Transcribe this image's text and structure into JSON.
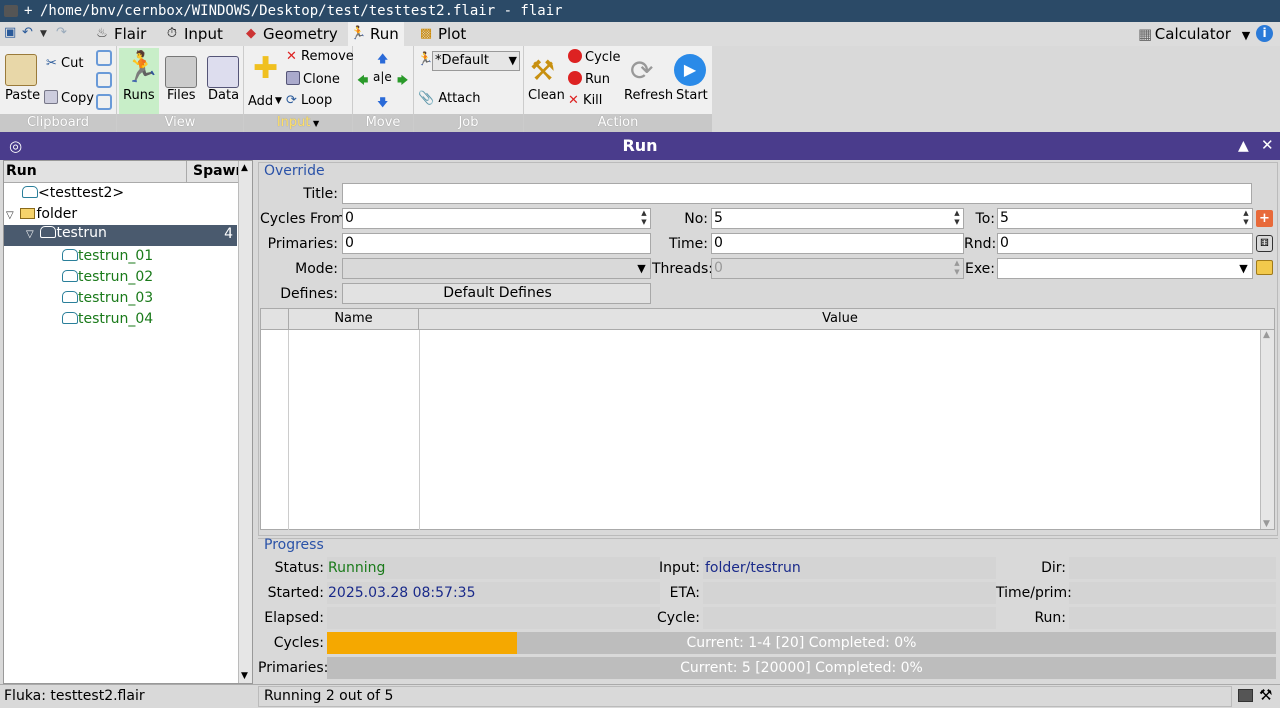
{
  "window": {
    "plus": "+",
    "title": "/home/bnv/cernbox/WINDOWS/Desktop/test/testtest2.flair - flair"
  },
  "tabs": [
    {
      "label": "Flair",
      "icon": "cauldron-icon"
    },
    {
      "label": "Input",
      "icon": "input-icon"
    },
    {
      "label": "Geometry",
      "icon": "geometry-icon"
    },
    {
      "label": "Run",
      "icon": "runner-icon"
    },
    {
      "label": "Plot",
      "icon": "plot-icon"
    }
  ],
  "calculator": "Calculator",
  "ribbon": {
    "clipboard": {
      "label": "Clipboard",
      "paste": "Paste",
      "cut": "Cut",
      "copy": "Copy"
    },
    "view": {
      "label": "View",
      "runs": "Runs",
      "files": "Files",
      "data": "Data"
    },
    "input": {
      "label": "Input",
      "add": "Add",
      "remove": "Remove",
      "clone": "Clone",
      "loop": "Loop"
    },
    "move": {
      "label": "Move"
    },
    "job": {
      "label": "Job",
      "default": "*Default",
      "attach": "Attach"
    },
    "action": {
      "label": "Action",
      "clean": "Clean",
      "cycle": "Cycle",
      "run": "Run",
      "kill": "Kill",
      "refresh": "Refresh",
      "start": "Start"
    }
  },
  "panel_title": "Run",
  "left": {
    "col_run": "Run",
    "col_spawn": "Spawn",
    "items": [
      {
        "label": "<testtest2>"
      },
      {
        "label": "folder"
      },
      {
        "label": "testrun",
        "spawn": "4"
      },
      {
        "label": "testrun_01"
      },
      {
        "label": "testrun_02"
      },
      {
        "label": "testrun_03"
      },
      {
        "label": "testrun_04"
      }
    ]
  },
  "override": {
    "section": "Override",
    "title_label": "Title:",
    "title_value": "",
    "cycles_from_label": "Cycles From:",
    "cycles_from": "0",
    "no_label": "No:",
    "no": "5",
    "to_label": "To:",
    "to": "5",
    "primaries_label": "Primaries:",
    "primaries": "0",
    "time_label": "Time:",
    "time": "0",
    "rnd_label": "Rnd:",
    "rnd": "0",
    "mode_label": "Mode:",
    "mode": "",
    "threads_label": "Threads:",
    "threads": "0",
    "exe_label": "Exe:",
    "exe": "",
    "defines_label": "Defines:",
    "defines_button": "Default Defines",
    "table_name": "Name",
    "table_value": "Value"
  },
  "progress": {
    "section": "Progress",
    "status_label": "Status:",
    "status": "Running",
    "input_label": "Input:",
    "input": "folder/testrun",
    "dir_label": "Dir:",
    "started_label": "Started:",
    "started": "2025.03.28 08:57:35",
    "eta_label": "ETA:",
    "timeprim_label": "Time/prim:",
    "elapsed_label": "Elapsed:",
    "cycle_label": "Cycle:",
    "run_label": "Run:",
    "cycles_label": "Cycles:",
    "cycles_text": "Current: 1-4 [20] Completed: 0%",
    "cycles_fraction": 0.2,
    "primaries_label": "Primaries:",
    "primaries_text": "Current: 5 [20000] Completed: 0%",
    "primaries_fraction": 0.0
  },
  "status": {
    "left": "Fluka: testtest2.flair",
    "right": "Running 2 out of 5"
  },
  "colors": {
    "accent": "#4a3c8c",
    "running": "#1a7a1a",
    "link": "#1a2a8a",
    "progress": "#f5a800"
  }
}
